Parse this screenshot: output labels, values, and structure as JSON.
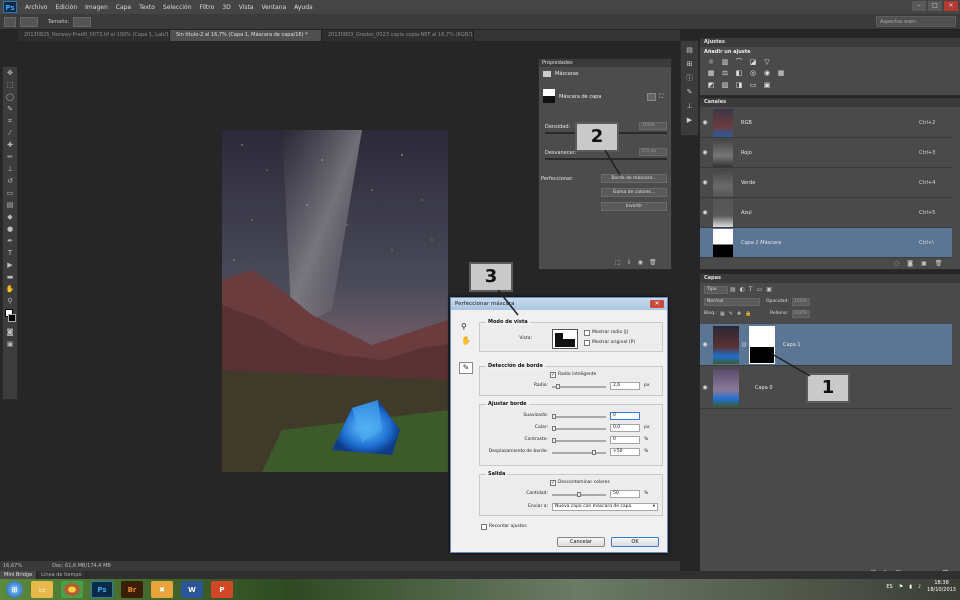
{
  "app": {
    "logo": "Ps"
  },
  "menu": [
    "Archivo",
    "Edición",
    "Imagen",
    "Capa",
    "Texto",
    "Selección",
    "Filtro",
    "3D",
    "Vista",
    "Ventana",
    "Ayuda"
  ],
  "options_bar": {
    "size_label": "Tamaño:",
    "workspace": "Aspectos esen."
  },
  "doc_tabs": [
    "20130825_Norway-Prad0_0073.tif al 100% (Capa 1, Lab/16) *",
    "Sin título-2 al 16,7% (Capa 1, Máscara de capa/16) *",
    "20130803_Gredos_0023 copia copia.NEF al 16,7% (RGB/16)"
  ],
  "status": {
    "zoom": "16,67%",
    "doc": "Doc: 61,6 MB/174,4 MB"
  },
  "mini_bridge": [
    "Mini Bridge",
    "Línea de tiempo"
  ],
  "properties": {
    "title": "Propiedades",
    "section": "Máscaras",
    "mask_label": "Máscara de capa",
    "density_label": "Densidad:",
    "density_value": "100%",
    "feather_label": "Desvanecer:",
    "feather_value": "0,0 px",
    "refine_label": "Perfeccionar:",
    "btn_mask_edge": "Borde de máscara...",
    "btn_color_range": "Gama de colores...",
    "btn_invert": "Invertir"
  },
  "adjustments": {
    "title": "Ajustes",
    "add_label": "Añadir un ajuste"
  },
  "channels": {
    "title": "Canales",
    "items": [
      {
        "name": "RGB",
        "key": "Ctrl+2"
      },
      {
        "name": "Rojo",
        "key": "Ctrl+3"
      },
      {
        "name": "Verde",
        "key": "Ctrl+4"
      },
      {
        "name": "Azul",
        "key": "Ctrl+5"
      },
      {
        "name": "Capa 1 Máscara",
        "key": "Ctrl+\\"
      }
    ]
  },
  "layers": {
    "title": "Capas",
    "filter": "Tipo",
    "blend_mode": "Normal",
    "opacity_label": "Opacidad:",
    "opacity_value": "100%",
    "lock_label": "Bloq.:",
    "fill_label": "Relleno:",
    "fill_value": "100%",
    "items": [
      {
        "name": "Capa 1"
      },
      {
        "name": "Capa 0"
      }
    ]
  },
  "dialog": {
    "title": "Perfeccionar máscara",
    "view_mode": {
      "title": "Modo de vista",
      "view_label": "Vista:",
      "show_radius": "Mostrar radio (J)",
      "show_original": "Mostrar original (P)"
    },
    "edge_detection": {
      "title": "Detección de borde",
      "smart_radius": "Radio inteligente",
      "radius_label": "Radio:",
      "radius_value": "2,6",
      "radius_unit": "px"
    },
    "adjust_edge": {
      "title": "Ajustar borde",
      "smooth_label": "Suavizado:",
      "smooth_value": "0",
      "feather_label": "Calar:",
      "feather_value": "0,0",
      "feather_unit": "px",
      "contrast_label": "Contraste:",
      "contrast_value": "0",
      "contrast_unit": "%",
      "shift_label": "Desplazamiento de borde:",
      "shift_value": "+50",
      "shift_unit": "%"
    },
    "output": {
      "title": "Salida",
      "decontaminate": "Descontaminar colores",
      "amount_label": "Cantidad:",
      "amount_value": "50",
      "amount_unit": "%",
      "send_label": "Enviar a:",
      "send_value": "Nueva capa con máscara de capa"
    },
    "remember": "Recordar ajustes",
    "cancel": "Cancelar",
    "ok": "OK"
  },
  "callouts": {
    "one": "1",
    "two": "2",
    "three": "3"
  },
  "taskbar": {
    "apps": [
      "Ps",
      "Br",
      "W",
      "P"
    ],
    "lang": "ES",
    "time": "18:38",
    "date": "18/10/2013"
  },
  "colors": {
    "ps_blue": "#3fa3f0",
    "panel_bg": "#4a4a4a",
    "selected_row": "#5b7595",
    "dialog_bg": "#f0f0f0"
  }
}
